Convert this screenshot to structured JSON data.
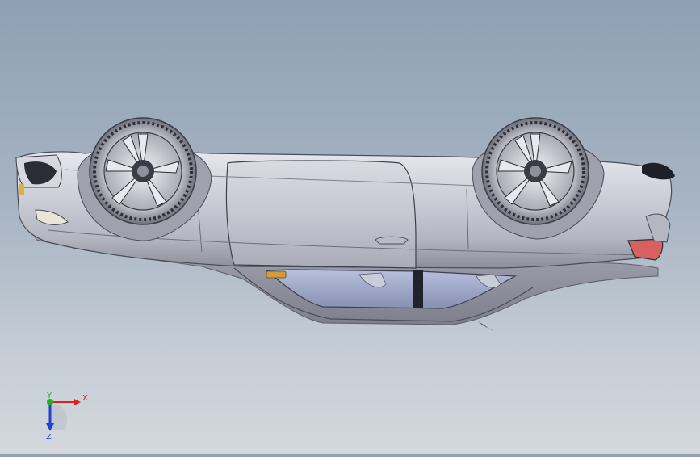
{
  "viewport": {
    "model_description": "car-model-upside-down",
    "background_top": "#8fa0b4",
    "background_bottom": "#d3d8dd",
    "body_color": "#c9cbd3",
    "shadow_color": "#8e909c",
    "glass_color": "#9ea8c7"
  },
  "triad": {
    "x_label": "X",
    "y_label": "Y",
    "z_label": "Z",
    "x_color": "#e02020",
    "y_color": "#22b022",
    "z_color": "#2040d0"
  }
}
